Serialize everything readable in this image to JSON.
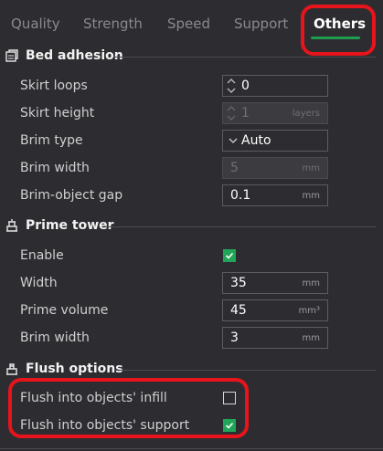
{
  "tabs": [
    {
      "label": "Quality"
    },
    {
      "label": "Strength"
    },
    {
      "label": "Speed"
    },
    {
      "label": "Support"
    },
    {
      "label": "Others",
      "active": true
    }
  ],
  "sections": {
    "bed_adhesion": {
      "title": "Bed adhesion",
      "skirt_loops": {
        "label": "Skirt loops",
        "value": "0"
      },
      "skirt_height": {
        "label": "Skirt height",
        "value": "1",
        "unit": "layers"
      },
      "brim_type": {
        "label": "Brim type",
        "value": "Auto"
      },
      "brim_width": {
        "label": "Brim width",
        "value": "5",
        "unit": "mm"
      },
      "brim_object_gap": {
        "label": "Brim-object gap",
        "value": "0.1",
        "unit": "mm"
      }
    },
    "prime_tower": {
      "title": "Prime tower",
      "enable": {
        "label": "Enable",
        "checked": true
      },
      "width": {
        "label": "Width",
        "value": "35",
        "unit": "mm"
      },
      "prime_volume": {
        "label": "Prime volume",
        "value": "45",
        "unit": "mm³"
      },
      "brim_width": {
        "label": "Brim width",
        "value": "3",
        "unit": "mm"
      }
    },
    "flush_options": {
      "title": "Flush options",
      "flush_infill": {
        "label": "Flush into objects' infill",
        "checked": false
      },
      "flush_support": {
        "label": "Flush into objects' support",
        "checked": true
      }
    }
  },
  "colors": {
    "accent": "#1f9d4f",
    "checkbox_on": "#21a558",
    "highlight": "#e8141c",
    "background": "#2d2d31"
  }
}
